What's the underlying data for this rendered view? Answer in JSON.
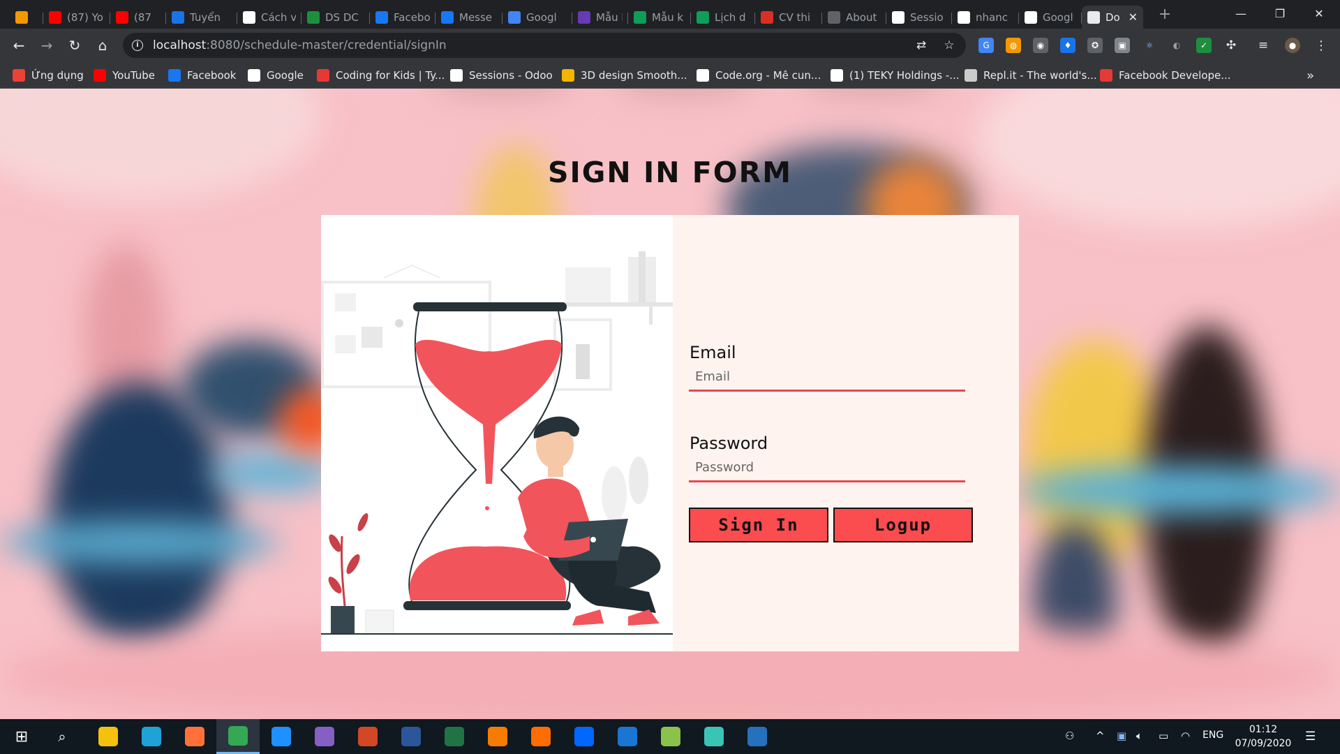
{
  "browser": {
    "tabs": [
      {
        "label": "",
        "icon": "orange-app-icon",
        "color": "#f29900"
      },
      {
        "label": "(87) Yo",
        "icon": "youtube-icon",
        "color": "#ff0000"
      },
      {
        "label": "(87",
        "icon": "youtube-icon",
        "color": "#ff0000"
      },
      {
        "label": "Tuyển",
        "icon": "translate-icon",
        "color": "#1a73e8"
      },
      {
        "label": "Cách v",
        "icon": "teky-icon",
        "color": "#ffffff"
      },
      {
        "label": "DS DC",
        "icon": "excel-x-icon",
        "color": "#1e8e3e"
      },
      {
        "label": "Facebo",
        "icon": "facebook-icon",
        "color": "#1877f2"
      },
      {
        "label": "Messe",
        "icon": "facebook-icon",
        "color": "#1877f2"
      },
      {
        "label": "Googl",
        "icon": "google-translate-icon",
        "color": "#4285f4"
      },
      {
        "label": "Mẫu k",
        "icon": "forms-icon",
        "color": "#673ab7"
      },
      {
        "label": "Mẫu k",
        "icon": "sheets-icon",
        "color": "#0f9d58"
      },
      {
        "label": "Lịch d",
        "icon": "sheets-icon",
        "color": "#0f9d58"
      },
      {
        "label": "CV thi",
        "icon": "gmail-icon",
        "color": "#d93025"
      },
      {
        "label": "About",
        "icon": "globe-icon",
        "color": "#5f6368"
      },
      {
        "label": "Sessio",
        "icon": "odoo-icon",
        "color": "#ffffff"
      },
      {
        "label": "nhanc",
        "icon": "github-icon",
        "color": "#ffffff"
      },
      {
        "label": "Googl",
        "icon": "google-icon",
        "color": "#ffffff"
      },
      {
        "label": "Do",
        "icon": "globe-icon",
        "color": "#e8eaed",
        "active": true
      }
    ],
    "new_tab_symbol": "+",
    "window_controls": {
      "minimize": "—",
      "maximize": "❐",
      "close": "✕"
    },
    "url_host": "localhost",
    "url_path": ":8080/schedule-master/credential/signIn",
    "bookmarks": [
      {
        "label": "Ứng dụng",
        "icon": "apps-grid-icon",
        "color": "#ea4335"
      },
      {
        "label": "YouTube",
        "icon": "youtube-icon",
        "color": "#ff0000"
      },
      {
        "label": "Facebook",
        "icon": "facebook-icon",
        "color": "#1877f2"
      },
      {
        "label": "Google",
        "icon": "google-icon",
        "color": "#ffffff"
      },
      {
        "label": "Coding for Kids | Ty...",
        "icon": "tynker-icon",
        "color": "#e53935"
      },
      {
        "label": "Sessions - Odoo",
        "icon": "odoo-icon",
        "color": "#ffffff"
      },
      {
        "label": "3D design Smooth...",
        "icon": "tinkercad-icon",
        "color": "#f4b400"
      },
      {
        "label": "Code.org - Mê cun...",
        "icon": "codeorg-icon",
        "color": "#ffffff"
      },
      {
        "label": "(1) TEKY Holdings -...",
        "icon": "workplace-icon",
        "color": "#ffffff"
      },
      {
        "label": "Repl.it - The world's...",
        "icon": "replit-icon",
        "color": "#cccccc"
      },
      {
        "label": "Facebook Develope...",
        "icon": "fb-dev-icon",
        "color": "#e53935"
      }
    ],
    "bookmarks_overflow": "»"
  },
  "page": {
    "title": "SIGN IN FORM",
    "email_label": "Email",
    "email_placeholder": "Email",
    "password_label": "Password",
    "password_placeholder": "Password",
    "signin_button": "Sign In",
    "logup_button": "Logup",
    "accent_color": "#fb4c4f"
  },
  "taskbar": {
    "apps": [
      {
        "name": "file-explorer-icon",
        "color": "#f4c20d"
      },
      {
        "name": "edge-beta-icon",
        "color": "#1fa2d8"
      },
      {
        "name": "firefox-icon",
        "color": "#ff7139"
      },
      {
        "name": "chrome-icon",
        "color": "#34a853",
        "active": true
      },
      {
        "name": "vscode-icon",
        "color": "#1e90ff"
      },
      {
        "name": "visual-studio-icon",
        "color": "#865fc5"
      },
      {
        "name": "powerpoint-icon",
        "color": "#d24726"
      },
      {
        "name": "word-icon",
        "color": "#2b579a"
      },
      {
        "name": "excel-icon",
        "color": "#217346"
      },
      {
        "name": "pdf-icon",
        "color": "#f57c00"
      },
      {
        "name": "pen-app-icon",
        "color": "#ff6d00"
      },
      {
        "name": "zalo-icon",
        "color": "#0068ff"
      },
      {
        "name": "3d-box-icon",
        "color": "#1976d2"
      },
      {
        "name": "paint-icon",
        "color": "#8bc34a"
      },
      {
        "name": "nox-icon",
        "color": "#39c4b6"
      },
      {
        "name": "powershell-icon",
        "color": "#2671be"
      }
    ],
    "language": "ENG",
    "time": "01:12",
    "date": "07/09/2020"
  }
}
